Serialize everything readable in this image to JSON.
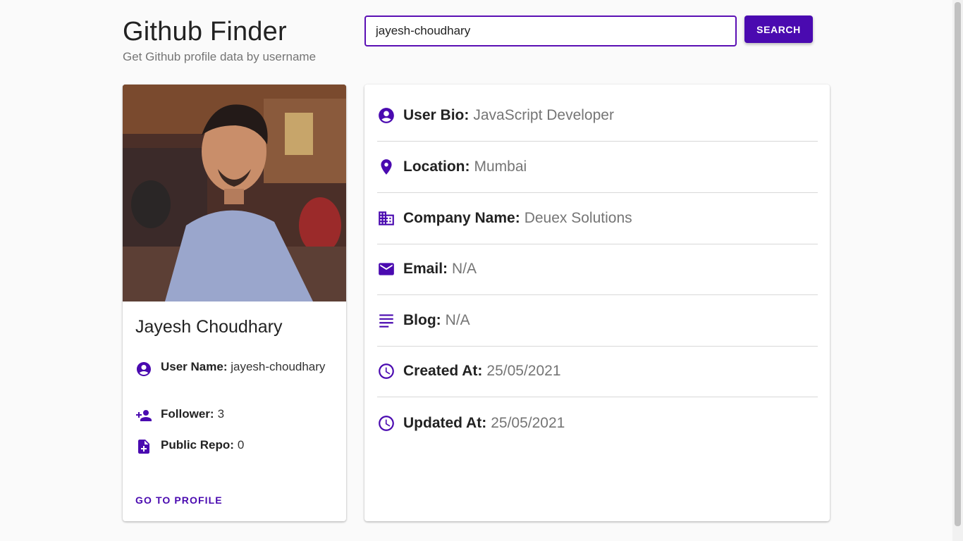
{
  "header": {
    "title": "Github Finder",
    "subtitle": "Get Github profile data by username"
  },
  "search": {
    "value": "jayesh-choudhary",
    "button_label": "SEARCH"
  },
  "profile": {
    "name": "Jayesh Choudhary",
    "username_label": "User Name:",
    "username_value": "jayesh-choudhary",
    "follower_label": "Follower:",
    "follower_value": "3",
    "repo_label": "Public Repo:",
    "repo_value": "0",
    "profile_link_label": "GO TO PROFILE",
    "icons": [
      "account-circle-icon",
      "person-add-icon",
      "note-add-icon"
    ]
  },
  "details": [
    {
      "label": "User Bio:",
      "value": "JavaScript Developer",
      "icon": "account-circle-icon"
    },
    {
      "label": "Location:",
      "value": "Mumbai",
      "icon": "location-pin-icon"
    },
    {
      "label": "Company Name:",
      "value": "Deuex Solutions",
      "icon": "building-icon"
    },
    {
      "label": "Email:",
      "value": "N/A",
      "icon": "mail-icon"
    },
    {
      "label": "Blog:",
      "value": "N/A",
      "icon": "lines-icon"
    },
    {
      "label": "Created At:",
      "value": "25/05/2021",
      "icon": "clock-icon"
    },
    {
      "label": "Updated At:",
      "value": "25/05/2021",
      "icon": "clock-icon"
    }
  ],
  "colors": {
    "accent": "#4a0ab0",
    "background": "#fafafa",
    "muted_text": "#757575"
  }
}
